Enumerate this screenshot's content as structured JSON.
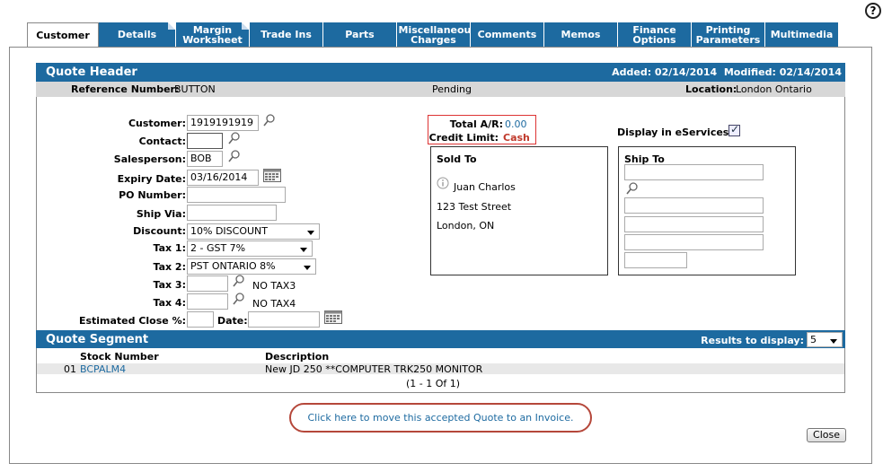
{
  "help_icon": "help-circle-icon",
  "tabs": [
    {
      "label": "Customer",
      "active": true
    },
    {
      "label": "Details"
    },
    {
      "label": "Margin Worksheet"
    },
    {
      "label": "Trade Ins"
    },
    {
      "label": "Parts"
    },
    {
      "label": "Miscellaneous Charges"
    },
    {
      "label": "Comments"
    },
    {
      "label": "Memos"
    },
    {
      "label": "Finance Options"
    },
    {
      "label": "Printing Parameters"
    },
    {
      "label": "Multimedia"
    }
  ],
  "quote_header": {
    "title": "Quote Header",
    "added": "Added: 02/14/2014",
    "modified": "Modified: 02/14/2014",
    "reference_label": "Reference Number:",
    "reference_value": "BUTTON",
    "status": "Pending",
    "location_label": "Location:",
    "location_value": "London Ontario"
  },
  "form": {
    "customer_label": "Customer:",
    "customer_value": "1919191919",
    "contact_label": "Contact:",
    "contact_value": "",
    "salesperson_label": "Salesperson:",
    "salesperson_value": "BOB",
    "expiry_label": "Expiry Date:",
    "expiry_value": "03/16/2014",
    "po_label": "PO Number:",
    "po_value": "",
    "shipvia_label": "Ship Via:",
    "shipvia_value": "",
    "discount_label": "Discount:",
    "discount_value": "10% DISCOUNT",
    "tax1_label": "Tax 1:",
    "tax1_value": "2 - GST 7%",
    "tax2_label": "Tax 2:",
    "tax2_value": "PST ONTARIO 8%",
    "tax3_label": "Tax 3:",
    "tax3_value": "",
    "tax3_desc": "NO TAX3",
    "tax4_label": "Tax 4:",
    "tax4_value": "",
    "tax4_desc": "NO TAX4",
    "close_pct_label": "Estimated Close %:",
    "close_pct_value": "",
    "date_label": "Date:",
    "date_value": ""
  },
  "ar": {
    "total_label": "Total A/R:",
    "total_value": "0.00",
    "credit_label": "Credit Limit:",
    "credit_value": "Cash"
  },
  "eservices": {
    "label": "Display in eServices:",
    "checked": true
  },
  "sold_to": {
    "title": "Sold To",
    "name": "Juan Charlos",
    "street": "123 Test Street",
    "city": "London, ON"
  },
  "ship_to": {
    "title": "Ship To"
  },
  "quote_segment": {
    "title": "Quote Segment",
    "results_label": "Results to display:",
    "results_value": "5",
    "col_stock": "Stock Number",
    "col_desc": "Description",
    "rows": [
      {
        "num": "01",
        "stock": "BCPALM4",
        "desc": "New JD 250 **COMPUTER TRK250 MONITOR"
      }
    ],
    "pager": "(1 - 1 Of 1)"
  },
  "cta": "Click here to move this accepted Quote to an Invoice.",
  "close_button": "Close"
}
